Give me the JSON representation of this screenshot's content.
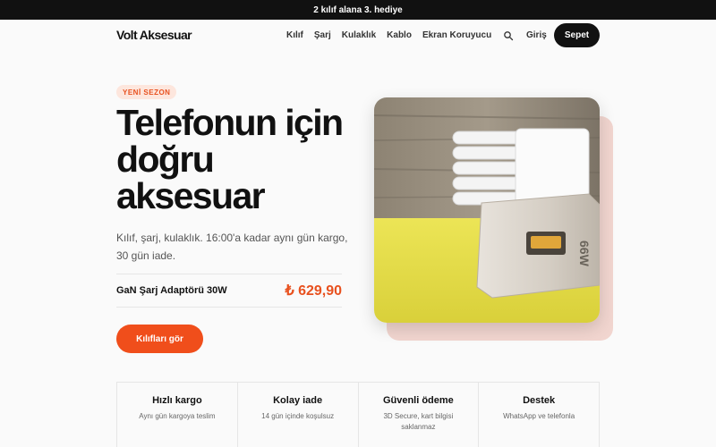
{
  "announcement": "2 kılıf alana 3. hediye",
  "header": {
    "logo": "Volt Aksesuar",
    "nav": [
      "Kılıf",
      "Şarj",
      "Kulaklık",
      "Kablo",
      "Ekran Koruyucu"
    ],
    "login": "Giriş",
    "cart": "Sepet",
    "search_icon": "search-icon"
  },
  "hero": {
    "badge": "YENİ SEZON",
    "title": "Telefonun için doğru aksesuar",
    "subtitle": "Kılıf, şarj, kulaklık. 16:00'a kadar aynı gün kargo, 30 gün iade.",
    "product_name": "GaN Şarj Adaptörü 30W",
    "product_price": "₺ 629,90",
    "cta": "Kılıfları gör",
    "image_text": "66W"
  },
  "features": [
    {
      "title": "Hızlı kargo",
      "desc": "Aynı gün kargoya teslim"
    },
    {
      "title": "Kolay iade",
      "desc": "14 gün içinde koşulsuz"
    },
    {
      "title": "Güvenli ödeme",
      "desc": "3D Secure, kart bilgisi saklanmaz"
    },
    {
      "title": "Destek",
      "desc": "WhatsApp ve telefonla"
    }
  ],
  "colors": {
    "accent": "#f04e1b",
    "dark": "#111111",
    "badge_bg": "#fde6dd",
    "yellow_surface": "#e6de3c"
  }
}
